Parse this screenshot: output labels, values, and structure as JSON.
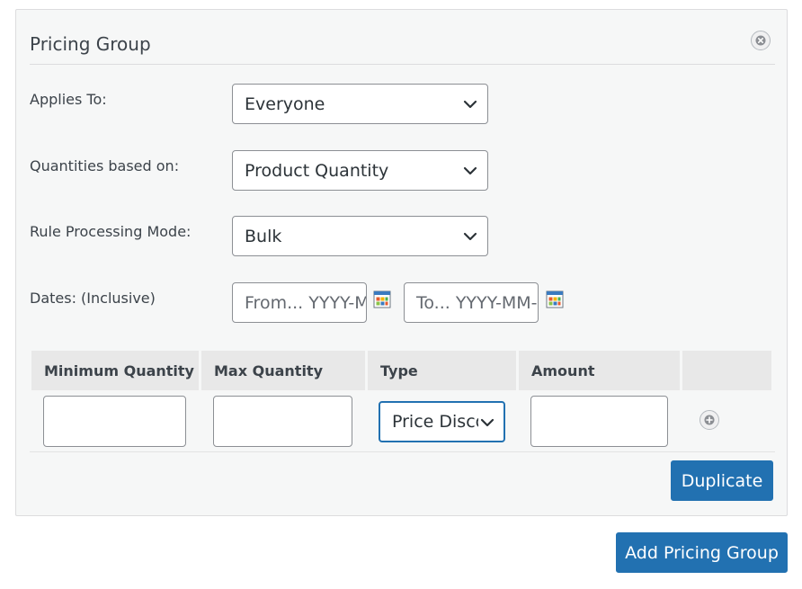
{
  "panel": {
    "title": "Pricing Group"
  },
  "fields": {
    "applies_to": {
      "label": "Applies To:",
      "value": "Everyone"
    },
    "quantities_based_on": {
      "label": "Quantities based on:",
      "value": "Product Quantity"
    },
    "rule_processing_mode": {
      "label": "Rule Processing Mode:",
      "value": "Bulk"
    },
    "dates": {
      "label": "Dates: (Inclusive)",
      "from_placeholder": "From... YYYY-MM-DD",
      "to_placeholder": "To... YYYY-MM-DD"
    }
  },
  "table": {
    "headers": [
      "Minimum Quantity",
      "Max Quantity",
      "Type",
      "Amount"
    ],
    "row": {
      "min_quantity": "",
      "max_quantity": "",
      "type": "Price Discount",
      "amount": ""
    }
  },
  "buttons": {
    "duplicate": "Duplicate",
    "add_pricing_group": "Add Pricing Group"
  },
  "colors": {
    "primary": "#2271b1",
    "panel_bg": "#f6f7f7",
    "header_bg": "#e8e8e8"
  }
}
